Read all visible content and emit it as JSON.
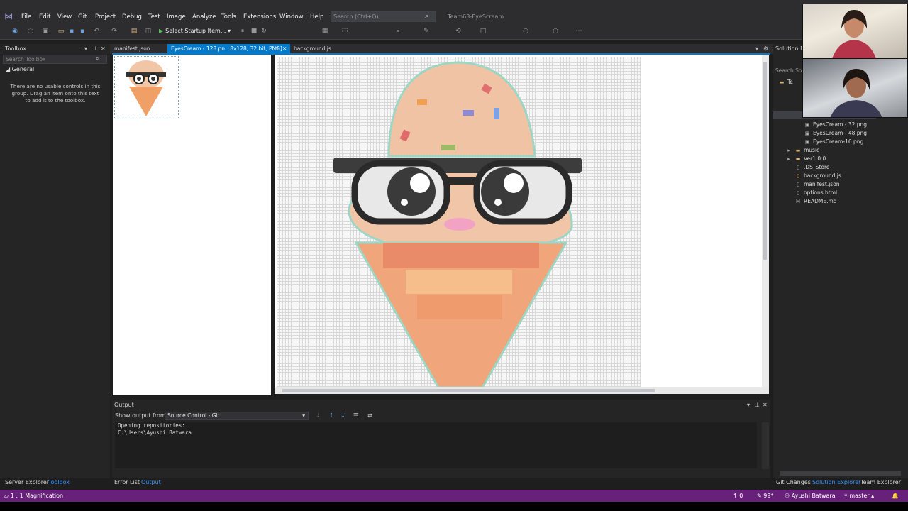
{
  "menu": {
    "items": [
      "File",
      "Edit",
      "View",
      "Git",
      "Project",
      "Debug",
      "Test",
      "Image",
      "Analyze",
      "Tools",
      "Extensions",
      "Window",
      "Help"
    ],
    "search_placeholder": "Search (Ctrl+Q)",
    "solution_name": "Team63-EyeScream"
  },
  "toolbar": {
    "start_label": "Select Startup Item..."
  },
  "toolbox": {
    "title": "Toolbox",
    "search_placeholder": "Search Toolbox",
    "group": "General",
    "empty_message": "There are no usable controls in this group. Drag an item onto this text to add it to the toolbox."
  },
  "editor": {
    "tabs": [
      {
        "label": "manifest.json",
        "active": false
      },
      {
        "label": "EyesCream - 128.pn...8x128, 32 bit, PNG]",
        "active": true
      },
      {
        "label": "background.js",
        "active": false
      }
    ]
  },
  "output": {
    "title": "Output",
    "show_from_label": "Show output from:",
    "source": "Source Control - Git",
    "lines": [
      "Opening repositories:",
      "C:\\Users\\Ayushi Batwara"
    ]
  },
  "bottom_tabs_left": [
    "Server Explorer",
    "Toolbox"
  ],
  "bottom_tabs_center": [
    "Error List",
    "Output"
  ],
  "solution_explorer": {
    "title": "Solution E",
    "search": "Search So",
    "items": [
      {
        "label": "Te",
        "icon": "folder-icon"
      },
      {
        "label": "EyesCream - 32.png",
        "icon": "image-file-icon"
      },
      {
        "label": "EyesCream - 48.png",
        "icon": "image-file-icon"
      },
      {
        "label": "EyesCream-16.png",
        "icon": "image-file-icon"
      },
      {
        "label": "music",
        "icon": "folder-icon"
      },
      {
        "label": "Ver1.0.0",
        "icon": "folder-icon"
      },
      {
        "label": ".DS_Store",
        "icon": "file-icon"
      },
      {
        "label": "background.js",
        "icon": "js-file-icon"
      },
      {
        "label": "manifest.json",
        "icon": "json-file-icon"
      },
      {
        "label": "options.html",
        "icon": "html-file-icon"
      },
      {
        "label": "README.md",
        "icon": "markdown-file-icon"
      }
    ],
    "bottom_tabs": [
      "Git Changes",
      "Solution Explorer",
      "Team Explorer"
    ]
  },
  "status": {
    "zoom": "1 : 1 Magnification",
    "errors": "0",
    "pencil_count": "99*",
    "user": "Ayushi Batwara",
    "branch": "master"
  },
  "colors": {
    "accent": "#007acc",
    "status_bar": "#68217a"
  }
}
